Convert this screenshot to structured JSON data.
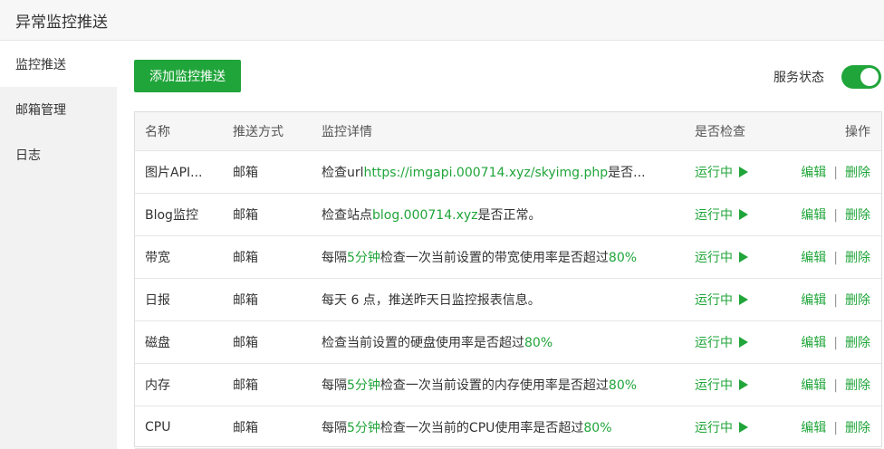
{
  "window": {
    "title": "异常监控推送"
  },
  "sidebar": {
    "items": [
      {
        "label": "监控推送"
      },
      {
        "label": "邮箱管理"
      },
      {
        "label": "日志"
      }
    ]
  },
  "toolbar": {
    "add_label": "添加监控推送",
    "service_label": "服务状态",
    "service_on": true
  },
  "table": {
    "headers": [
      "名称",
      "推送方式",
      "监控详情",
      "是否检查",
      "操作"
    ],
    "rows": [
      {
        "name": "图片API...",
        "method": "邮箱",
        "detail": [
          "检查url",
          "https://imgapi.000714.xyz/skyimg.php",
          "是否..."
        ],
        "status": "运行中",
        "edit": "编辑",
        "delete": "删除"
      },
      {
        "name": "Blog监控",
        "method": "邮箱",
        "detail": [
          "检查站点",
          "blog.000714.xyz",
          "是否正常。"
        ],
        "status": "运行中",
        "edit": "编辑",
        "delete": "删除"
      },
      {
        "name": "带宽",
        "method": "邮箱",
        "detail": [
          "每隔",
          "5分钟",
          "检查一次当前设置的带宽使用率是否超过",
          "80%"
        ],
        "status": "运行中",
        "edit": "编辑",
        "delete": "删除"
      },
      {
        "name": "日报",
        "method": "邮箱",
        "detail": [
          "每天 6 点，推送昨天日监控报表信息。"
        ],
        "status": "运行中",
        "edit": "编辑",
        "delete": "删除"
      },
      {
        "name": "磁盘",
        "method": "邮箱",
        "detail": [
          "检查当前设置的硬盘使用率是否超过",
          "80%"
        ],
        "status": "运行中",
        "edit": "编辑",
        "delete": "删除"
      },
      {
        "name": "内存",
        "method": "邮箱",
        "detail": [
          "每隔",
          "5分钟",
          "检查一次当前设置的内存使用率是否超过",
          "80%"
        ],
        "status": "运行中",
        "edit": "编辑",
        "delete": "删除"
      },
      {
        "name": "CPU",
        "method": "邮箱",
        "detail": [
          "每隔",
          "5分钟",
          "检查一次当前的CPU使用率是否超过",
          "80%"
        ],
        "status": "运行中",
        "edit": "编辑",
        "delete": "删除"
      }
    ],
    "separator": "|"
  },
  "colors": {
    "accent": "#20a53a",
    "sidebar_bg": "#f2f2f2",
    "header_bg": "#f6f6f6"
  }
}
